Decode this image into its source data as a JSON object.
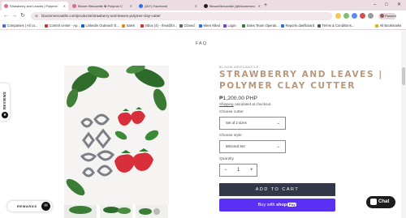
{
  "browser": {
    "tabs": [
      {
        "label": "Strawberry and Leaves | Polymer",
        "favicon_color": "#e06a8e",
        "active": true
      },
      {
        "label": "Bloom Mercantile ✿ Polymer C",
        "favicon_color": "#e06a8e",
        "active": false
      },
      {
        "label": "(20+) Facebook",
        "favicon_color": "#1877f2",
        "active": false
      },
      {
        "label": "BloomMercantile (@bloommerc",
        "favicon_color": "#222222",
        "active": false
      }
    ],
    "new_tab": "+",
    "window_controls": {
      "minimize": "–",
      "maximize": "□",
      "close": "✕"
    },
    "nav": {
      "back": "←",
      "forward": "→",
      "reload": "↻"
    },
    "url": "bloommercantile.com/products/strawberry-and-leaves-polymer-clay-cutter",
    "profile_button": "Paused",
    "bookmarks": [
      {
        "label": "Companies | All co...",
        "icon_color": "#3b6fd6"
      },
      {
        "label": "Control center - Ap...",
        "icon_color": "#cc3333"
      },
      {
        "label": "Linkedin Outreach E...",
        "icon_color": "#0a66c2"
      },
      {
        "label": "Sales",
        "icon_color": "#e0861a"
      },
      {
        "label": "Inbox (4) - rhea@bl...",
        "icon_color": "#d93025"
      },
      {
        "label": "Closed",
        "icon_color": "#5f6368"
      },
      {
        "label": "Meet Allied",
        "icon_color": "#1a73e8"
      },
      {
        "label": "Login",
        "icon_color": "#7a3bd6"
      },
      {
        "label": "Sales Team Operati...",
        "icon_color": "#2e7d32"
      },
      {
        "label": "Reports dashboard",
        "icon_color": "#1a73e8"
      },
      {
        "label": "Terms & Conditions...",
        "icon_color": "#555555"
      }
    ],
    "all_bookmarks": "All Bookmarks"
  },
  "site": {
    "nav_link": "FAQ",
    "reviews_tab": "REVIEWS",
    "rewards_label": "REWARDS",
    "chat_label": "Chat"
  },
  "product": {
    "vendor": "BLOOM MERCANTILE",
    "title": "STRAWBERRY AND LEAVES | POLYMER CLAY CUTTER",
    "price": "₱1,200.00 PHP",
    "shipping_link": "Shipping",
    "shipping_rest": " calculated at checkout.",
    "option1_label": "Choose cutter",
    "option1_value": "Set of 2 sizes",
    "option2_label": "Choose style",
    "option2_value": "Mirrored Set",
    "quantity_label": "Quantity",
    "quantity_minus": "−",
    "quantity_value": "1",
    "quantity_plus": "+",
    "add_to_cart": "ADD TO CART",
    "buy_with": "Buy with",
    "shop_pay": "shop",
    "pay_badge": "Pay"
  },
  "colors": {
    "title_accent": "#b9977a",
    "add_to_cart_bg": "#323848",
    "shop_pay_bg": "#5a31f4",
    "strawberry_red": "#d8303a"
  }
}
